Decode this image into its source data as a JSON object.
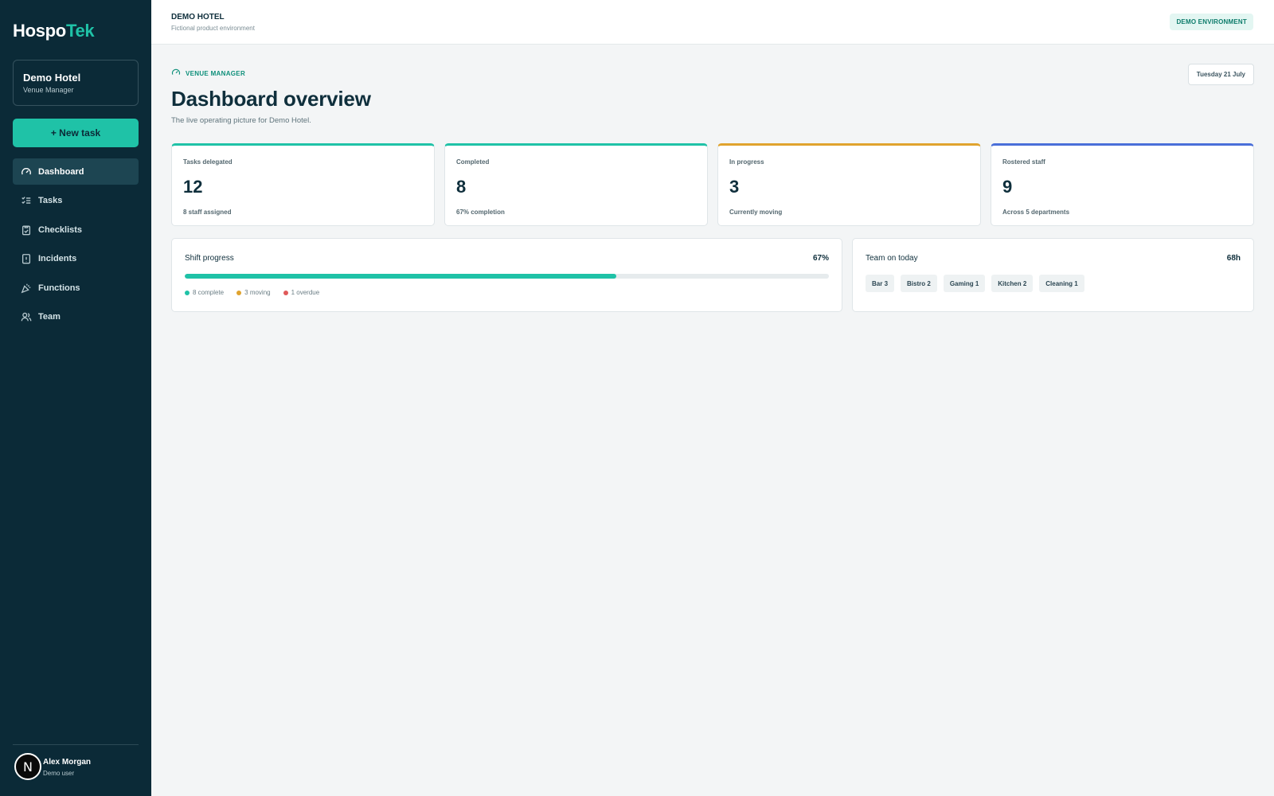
{
  "brand": {
    "name_main": "Hospo",
    "name_accent": "Tek",
    "accent_color": "#1fc2a7",
    "sidebar_color": "#0b2a37"
  },
  "venue": {
    "name": "Demo Hotel",
    "role": "Venue Manager"
  },
  "new_task_label": "+ New task",
  "nav": [
    {
      "label": "Dashboard",
      "icon": "gauge-icon",
      "active": true
    },
    {
      "label": "Tasks",
      "icon": "list-check-icon"
    },
    {
      "label": "Checklists",
      "icon": "clipboard-icon"
    },
    {
      "label": "Incidents",
      "icon": "alert-file-icon"
    },
    {
      "label": "Functions",
      "icon": "party-icon"
    },
    {
      "label": "Team",
      "icon": "users-icon"
    }
  ],
  "user": {
    "name": "Alex Morgan",
    "sub": "Demo user",
    "avatar_letter": "N"
  },
  "header": {
    "title": "DEMO HOTEL",
    "subtitle": "Fictional product environment",
    "env_badge": "DEMO ENVIRONMENT"
  },
  "page": {
    "eyebrow": "VENUE MANAGER",
    "date": "Tuesday 21 July",
    "title": "Dashboard overview",
    "subtitle": "The live operating picture for Demo Hotel."
  },
  "stats": [
    {
      "label": "Tasks delegated",
      "value": "12",
      "foot": "8 staff assigned",
      "color": "#1fc2a7"
    },
    {
      "label": "Completed",
      "value": "8",
      "foot": "67% completion",
      "color": "#1fc2a7"
    },
    {
      "label": "In progress",
      "value": "3",
      "foot": "Currently moving",
      "color": "#e0a32e"
    },
    {
      "label": "Rostered staff",
      "value": "9",
      "foot": "Across 5 departments",
      "color": "#4a6fd9"
    }
  ],
  "shift_progress": {
    "title": "Shift progress",
    "value": "67%",
    "fraction": 0.67,
    "legend": [
      {
        "label": "8 complete",
        "color": "#1fc2a7"
      },
      {
        "label": "3 moving",
        "color": "#e0a32e"
      },
      {
        "label": "1 overdue",
        "color": "#e05a5a"
      }
    ]
  },
  "team_today": {
    "title": "Team on today",
    "value": "68h",
    "chips": [
      "Bar 3",
      "Bistro 2",
      "Gaming 1",
      "Kitchen 2",
      "Cleaning 1"
    ]
  }
}
